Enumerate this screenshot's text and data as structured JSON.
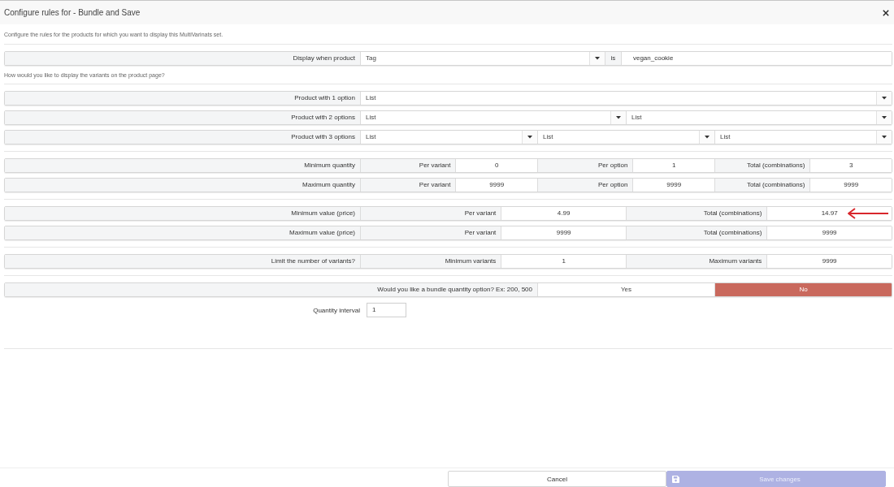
{
  "dialog": {
    "title": "Configure rules for - Bundle and Save"
  },
  "intro": "Configure the rules for the products for which you want to display this MultiVarinats set.",
  "condition": {
    "label": "Display when product",
    "field": "Tag",
    "operator": "is",
    "value": "vegan_cookie"
  },
  "display_prompt": "How would you like to display the variants on the product page?",
  "display_rows": [
    {
      "label": "Product with 1 option",
      "selects": [
        "List"
      ]
    },
    {
      "label": "Product with 2 options",
      "selects": [
        "List",
        "List"
      ]
    },
    {
      "label": "Product with 3 options",
      "selects": [
        "List",
        "List",
        "List"
      ]
    }
  ],
  "quantity_rows": [
    {
      "label": "Minimum quantity",
      "cells": [
        {
          "label": "Per variant",
          "value": "0",
          "marked": false
        },
        {
          "label": "Per option",
          "value": "1",
          "marked": false
        },
        {
          "label": "Total (combinations)",
          "value": "3",
          "marked": false
        }
      ]
    },
    {
      "label": "Maximum quantity",
      "cells": [
        {
          "label": "Per variant",
          "value": "9999",
          "marked": false
        },
        {
          "label": "Per option",
          "value": "9999",
          "marked": false
        },
        {
          "label": "Total (combinations)",
          "value": "9999",
          "marked": false
        }
      ]
    }
  ],
  "value_rows": [
    {
      "label": "Minimum value (price)",
      "cells": [
        {
          "label": "Per variant",
          "value": "4.99",
          "marked": false
        },
        {
          "label": "Total (combinations)",
          "value": "14.97",
          "marked": true
        }
      ]
    },
    {
      "label": "Maximum value (price)",
      "cells": [
        {
          "label": "Per variant",
          "value": "9999",
          "marked": false
        },
        {
          "label": "Total (combinations)",
          "value": "9999",
          "marked": false
        }
      ]
    }
  ],
  "variant_limit_rows": [
    {
      "label": "Limit the number of variants?",
      "cells": [
        {
          "label": "Minimum variants",
          "value": "1",
          "marked": false
        },
        {
          "label": "Maximum variants",
          "value": "9999",
          "marked": false
        }
      ]
    }
  ],
  "bundle": {
    "question": "Would you like a bundle quantity option? Ex: 200, 500",
    "options": [
      {
        "label": "Yes",
        "selected": false
      },
      {
        "label": "No",
        "selected": true
      }
    ]
  },
  "quantity_interval": {
    "label": "Quantity interval",
    "value": "1"
  },
  "buttons": [
    {
      "label": "Cancel",
      "kind": "secondary",
      "disabled": false
    },
    {
      "label": "Save changes",
      "kind": "primary",
      "disabled": true
    }
  ]
}
